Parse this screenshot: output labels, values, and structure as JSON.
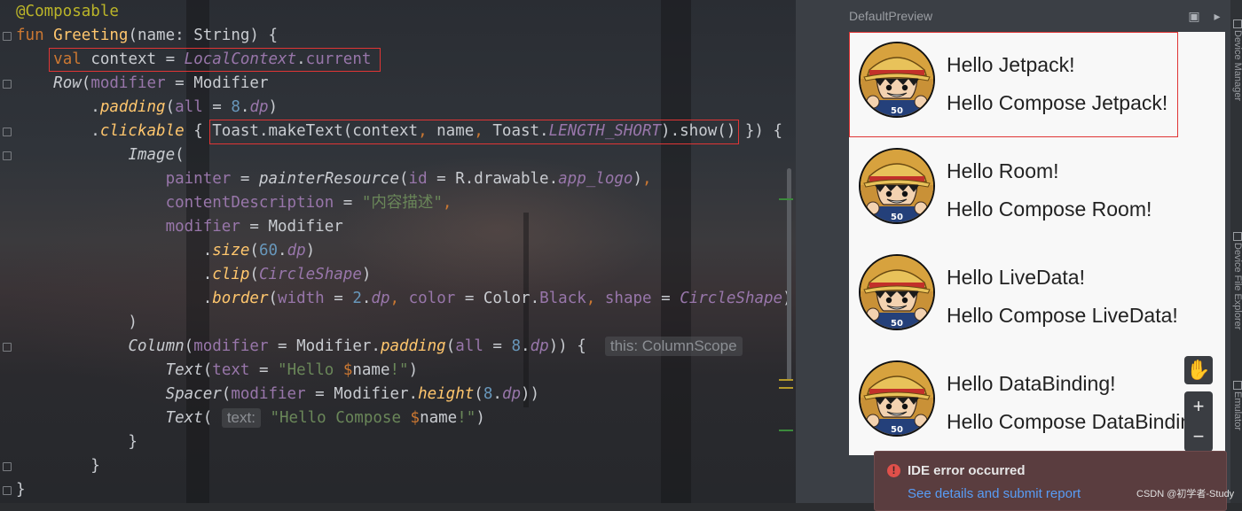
{
  "editor": {
    "lines": [
      [
        [
          "ann",
          "@Composable"
        ]
      ],
      [
        [
          "kw",
          "fun "
        ],
        [
          "fn",
          "Greeting"
        ],
        [
          "plain",
          "(name: String) {"
        ]
      ],
      [
        [
          "plain",
          "    "
        ],
        [
          "kw",
          "val "
        ],
        [
          "plain",
          "context = "
        ],
        [
          "pr it",
          "LocalContext"
        ],
        [
          "plain",
          "."
        ],
        [
          "pr",
          "current"
        ]
      ],
      [
        [
          "plain",
          "    "
        ],
        [
          "plain it",
          "Row"
        ],
        [
          "plain",
          "("
        ],
        [
          "pr",
          "modifier"
        ],
        [
          "plain",
          " = Modifier"
        ]
      ],
      [
        [
          "plain",
          "        ."
        ],
        [
          "ext",
          "padding"
        ],
        [
          "plain",
          "("
        ],
        [
          "pr",
          "all"
        ],
        [
          "plain",
          " = "
        ],
        [
          "num",
          "8"
        ],
        [
          "plain",
          "."
        ],
        [
          "pr it",
          "dp"
        ],
        [
          "plain",
          ")"
        ]
      ],
      [
        [
          "plain",
          "        ."
        ],
        [
          "ext",
          "clickable"
        ],
        [
          "plain",
          " { Toast.makeText(context"
        ],
        [
          "kw",
          ","
        ],
        [
          "plain",
          " name"
        ],
        [
          "kw",
          ","
        ],
        [
          "plain",
          " Toast."
        ],
        [
          "pr it",
          "LENGTH_SHORT"
        ],
        [
          "plain",
          ").show() }) {"
        ]
      ],
      [
        [
          "plain",
          "            "
        ],
        [
          "plain it",
          "Image"
        ],
        [
          "plain",
          "("
        ]
      ],
      [
        [
          "plain",
          "                "
        ],
        [
          "pr",
          "painter"
        ],
        [
          "plain",
          " = "
        ],
        [
          "plain it",
          "painterResource"
        ],
        [
          "plain",
          "("
        ],
        [
          "pr",
          "id"
        ],
        [
          "plain",
          " = R.drawable."
        ],
        [
          "pr it",
          "app_logo"
        ],
        [
          "plain",
          ")"
        ],
        [
          "kw",
          ","
        ]
      ],
      [
        [
          "plain",
          "                "
        ],
        [
          "pr",
          "contentDescription"
        ],
        [
          "plain",
          " = "
        ],
        [
          "str",
          "\"内容描述\""
        ],
        [
          "kw",
          ","
        ]
      ],
      [
        [
          "plain",
          "                "
        ],
        [
          "pr",
          "modifier"
        ],
        [
          "plain",
          " = Modifier"
        ]
      ],
      [
        [
          "plain",
          "                    ."
        ],
        [
          "ext",
          "size"
        ],
        [
          "plain",
          "("
        ],
        [
          "num",
          "60"
        ],
        [
          "plain",
          "."
        ],
        [
          "pr it",
          "dp"
        ],
        [
          "plain",
          ")"
        ]
      ],
      [
        [
          "plain",
          "                    ."
        ],
        [
          "ext",
          "clip"
        ],
        [
          "plain",
          "("
        ],
        [
          "pr it",
          "CircleShape"
        ],
        [
          "plain",
          ")"
        ]
      ],
      [
        [
          "plain",
          "                    ."
        ],
        [
          "ext",
          "border"
        ],
        [
          "plain",
          "("
        ],
        [
          "pr",
          "width"
        ],
        [
          "plain",
          " = "
        ],
        [
          "num",
          "2"
        ],
        [
          "plain",
          "."
        ],
        [
          "pr it",
          "dp"
        ],
        [
          "kw",
          ","
        ],
        [
          "plain",
          " "
        ],
        [
          "pr",
          "color"
        ],
        [
          "plain",
          " = Color."
        ],
        [
          "pr",
          "Black"
        ],
        [
          "kw",
          ","
        ],
        [
          "plain",
          " "
        ],
        [
          "pr",
          "shape"
        ],
        [
          "plain",
          " = "
        ],
        [
          "pr it",
          "CircleShape"
        ],
        [
          "plain",
          ")"
        ]
      ],
      [
        [
          "plain",
          "            )"
        ]
      ],
      [
        [
          "plain",
          "            "
        ],
        [
          "plain it",
          "Column"
        ],
        [
          "plain",
          "("
        ],
        [
          "pr",
          "modifier"
        ],
        [
          "plain",
          " = Modifier."
        ],
        [
          "ext",
          "padding"
        ],
        [
          "plain",
          "("
        ],
        [
          "pr",
          "all"
        ],
        [
          "plain",
          " = "
        ],
        [
          "num",
          "8"
        ],
        [
          "plain",
          "."
        ],
        [
          "pr it",
          "dp"
        ],
        [
          "plain",
          ")) {  "
        ],
        [
          "hint",
          "this: ColumnScope"
        ]
      ],
      [
        [
          "plain",
          "                "
        ],
        [
          "plain it",
          "Text"
        ],
        [
          "plain",
          "("
        ],
        [
          "pr",
          "text"
        ],
        [
          "plain",
          " = "
        ],
        [
          "str",
          "\"Hello "
        ],
        [
          "kw",
          "$"
        ],
        [
          "plain",
          "name"
        ],
        [
          "str",
          "!\""
        ],
        [
          "plain",
          ")"
        ]
      ],
      [
        [
          "plain",
          "                "
        ],
        [
          "plain it",
          "Spacer"
        ],
        [
          "plain",
          "("
        ],
        [
          "pr",
          "modifier"
        ],
        [
          "plain",
          " = Modifier."
        ],
        [
          "ext",
          "height"
        ],
        [
          "plain",
          "("
        ],
        [
          "num",
          "8"
        ],
        [
          "plain",
          "."
        ],
        [
          "pr it",
          "dp"
        ],
        [
          "plain",
          "))"
        ]
      ],
      [
        [
          "plain",
          "                "
        ],
        [
          "plain it",
          "Text"
        ],
        [
          "plain",
          "( "
        ],
        [
          "hint",
          "text:"
        ],
        [
          "plain",
          " "
        ],
        [
          "str",
          "\"Hello Compose "
        ],
        [
          "kw",
          "$"
        ],
        [
          "plain",
          "name"
        ],
        [
          "str",
          "!\""
        ],
        [
          "plain",
          ")"
        ]
      ],
      [
        [
          "plain",
          "            }"
        ]
      ],
      [
        [
          "plain",
          "        }"
        ]
      ],
      [
        [
          "plain",
          "}"
        ]
      ]
    ]
  },
  "preview": {
    "title": "DefaultPreview",
    "cards": [
      {
        "line1": "Hello Jetpack!",
        "line2": "Hello Compose Jetpack!"
      },
      {
        "line1": "Hello Room!",
        "line2": "Hello Compose Room!"
      },
      {
        "line1": "Hello LiveData!",
        "line2": "Hello Compose LiveData!"
      },
      {
        "line1": "Hello DataBinding!",
        "line2": "Hello Compose DataBinding!"
      }
    ],
    "tools": {
      "pan": "✋",
      "zoom_in": "+",
      "zoom_out": "−"
    }
  },
  "side_tabs": [
    "Device Manager",
    "Device File Explorer",
    "Emulator"
  ],
  "notification": {
    "title": "IDE error occurred",
    "link": "See details and submit report",
    "icon": "!"
  },
  "watermark": "CSDN @初学者-Study"
}
